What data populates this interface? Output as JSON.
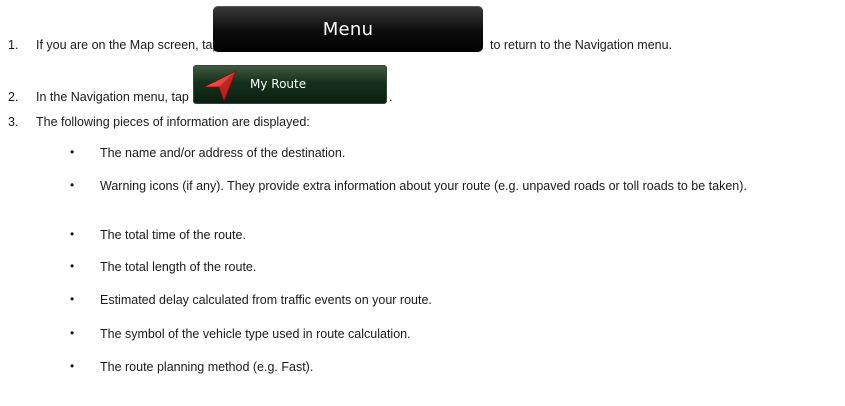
{
  "steps": [
    {
      "num": "1.",
      "before": "If you are on the Map screen, tap",
      "after": "to return to the Navigation menu."
    },
    {
      "num": "2.",
      "before": "In the Navigation menu, tap",
      "after": "."
    },
    {
      "num": "3.",
      "text": "The following pieces of information are displayed:"
    }
  ],
  "menu_button": {
    "label": "Menu"
  },
  "my_route_button": {
    "label": "My Route",
    "icon": "route-arrow-icon"
  },
  "bullets": [
    "The name and/or address of the destination.",
    "Warning icons (if any). They provide extra information about your route (e.g. unpaved roads or toll roads to be taken).",
    "The total time of the route.",
    "The total length of the route.",
    "Estimated delay calculated from traffic events on your route.",
    "The symbol of the vehicle type used in route calculation.",
    "The route planning method (e.g. Fast)."
  ],
  "bullet_symbol": "•",
  "colors": {
    "menu_button_bg": "#000000",
    "route_button_bg": "#14301c",
    "route_arrow": "#e03030"
  }
}
